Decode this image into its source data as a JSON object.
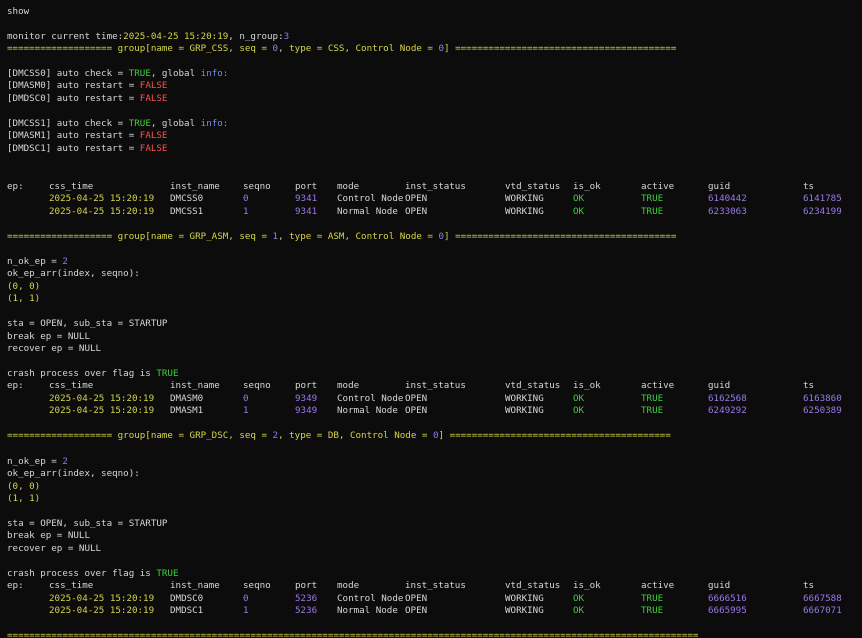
{
  "terminal": {
    "command": "show",
    "monitor": {
      "prefix": "monitor current time:",
      "time": "2025-04-25 15:20:19",
      "mid": ", n_group:",
      "n_group": "3"
    },
    "groups": [
      {
        "header_left": "=================== group[name = GRP_CSS, seq = ",
        "seq": "0",
        "header_mid": ", type = CSS, Control Node = ",
        "control_node": "0",
        "header_right": "] ========================================",
        "checks": [
          {
            "tag": "[DMCSS0]",
            "text": " auto check = ",
            "val": "TRUE",
            "suffix": ", global ",
            "info": "info:"
          },
          {
            "tag": "[DMASM0]",
            "text": " auto restart = ",
            "val": "FALSE",
            "suffix": "",
            "info": ""
          },
          {
            "tag": "[DMDSC0]",
            "text": " auto restart = ",
            "val": "FALSE",
            "suffix": "",
            "info": ""
          },
          {
            "tag": "[DMCSS1]",
            "text": " auto check = ",
            "val": "TRUE",
            "suffix": ", global ",
            "info": "info:"
          },
          {
            "tag": "[DMASM1]",
            "text": " auto restart = ",
            "val": "FALSE",
            "suffix": "",
            "info": ""
          },
          {
            "tag": "[DMDSC1]",
            "text": " auto restart = ",
            "val": "FALSE",
            "suffix": "",
            "info": ""
          }
        ],
        "rows": [
          {
            "css_time": "2025-04-25 15:20:19",
            "inst_name": "DMCSS0",
            "seqno": "0",
            "port": "9341",
            "mode": "Control Node",
            "inst_status": "OPEN",
            "vtd_status": "WORKING",
            "is_ok": "OK",
            "active": "TRUE",
            "guid": "6140442",
            "ts": "6141785"
          },
          {
            "css_time": "2025-04-25 15:20:19",
            "inst_name": "DMCSS1",
            "seqno": "1",
            "port": "9341",
            "mode": "Normal Node",
            "inst_status": "OPEN",
            "vtd_status": "WORKING",
            "is_ok": "OK",
            "active": "TRUE",
            "guid": "6233063",
            "ts": "6234199"
          }
        ]
      },
      {
        "header_left": "=================== group[name = GRP_ASM, seq = ",
        "seq": "1",
        "header_mid": ", type = ASM, Control Node = ",
        "control_node": "0",
        "header_right": "] ========================================",
        "n_ok_ep_label": "n_ok_ep = ",
        "n_ok_ep": "2",
        "ok_ep_arr": "ok_ep_arr(index, seqno):",
        "pairs": [
          "(0, 0)",
          "(1, 1)"
        ],
        "sta_line": "sta = OPEN, sub_sta = STARTUP",
        "break_ep": "break ep = NULL",
        "recover_ep": "recover ep = NULL",
        "crash_label": "crash process over flag is ",
        "crash_val": "TRUE",
        "rows": [
          {
            "css_time": "2025-04-25 15:20:19",
            "inst_name": "DMASM0",
            "seqno": "0",
            "port": "9349",
            "mode": "Control Node",
            "inst_status": "OPEN",
            "vtd_status": "WORKING",
            "is_ok": "OK",
            "active": "TRUE",
            "guid": "6162568",
            "ts": "6163860"
          },
          {
            "css_time": "2025-04-25 15:20:19",
            "inst_name": "DMASM1",
            "seqno": "1",
            "port": "9349",
            "mode": "Normal Node",
            "inst_status": "OPEN",
            "vtd_status": "WORKING",
            "is_ok": "OK",
            "active": "TRUE",
            "guid": "6249292",
            "ts": "6250389"
          }
        ]
      },
      {
        "header_left": "=================== group[name = GRP_DSC, seq = ",
        "seq": "2",
        "header_mid": ", type = DB, Control Node = ",
        "control_node": "0",
        "header_right": "] ========================================",
        "n_ok_ep_label": "n_ok_ep = ",
        "n_ok_ep": "2",
        "ok_ep_arr": "ok_ep_arr(index, seqno):",
        "pairs": [
          "(0, 0)",
          "(1, 1)"
        ],
        "sta_line": "sta = OPEN, sub_sta = STARTUP",
        "break_ep": "break ep = NULL",
        "recover_ep": "recover ep = NULL",
        "crash_label": "crash process over flag is ",
        "crash_val": "TRUE",
        "rows": [
          {
            "css_time": "2025-04-25 15:20:19",
            "inst_name": "DMDSC0",
            "seqno": "0",
            "port": "5236",
            "mode": "Control Node",
            "inst_status": "OPEN",
            "vtd_status": "WORKING",
            "is_ok": "OK",
            "active": "TRUE",
            "guid": "6666516",
            "ts": "6667588"
          },
          {
            "css_time": "2025-04-25 15:20:19",
            "inst_name": "DMDSC1",
            "seqno": "1",
            "port": "5236",
            "mode": "Normal Node",
            "inst_status": "OPEN",
            "vtd_status": "WORKING",
            "is_ok": "OK",
            "active": "TRUE",
            "guid": "6665995",
            "ts": "6667071"
          }
        ]
      }
    ],
    "table_headers": {
      "ep": "ep:",
      "css_time": "css_time",
      "inst_name": "inst_name",
      "seqno": "seqno",
      "port": "port",
      "mode": "mode",
      "inst_status": "inst_status",
      "vtd_status": "vtd_status",
      "is_ok": "is_ok",
      "active": "active",
      "guid": "guid",
      "ts": "ts"
    },
    "footer_rule": "============================================================================================================================="
  }
}
